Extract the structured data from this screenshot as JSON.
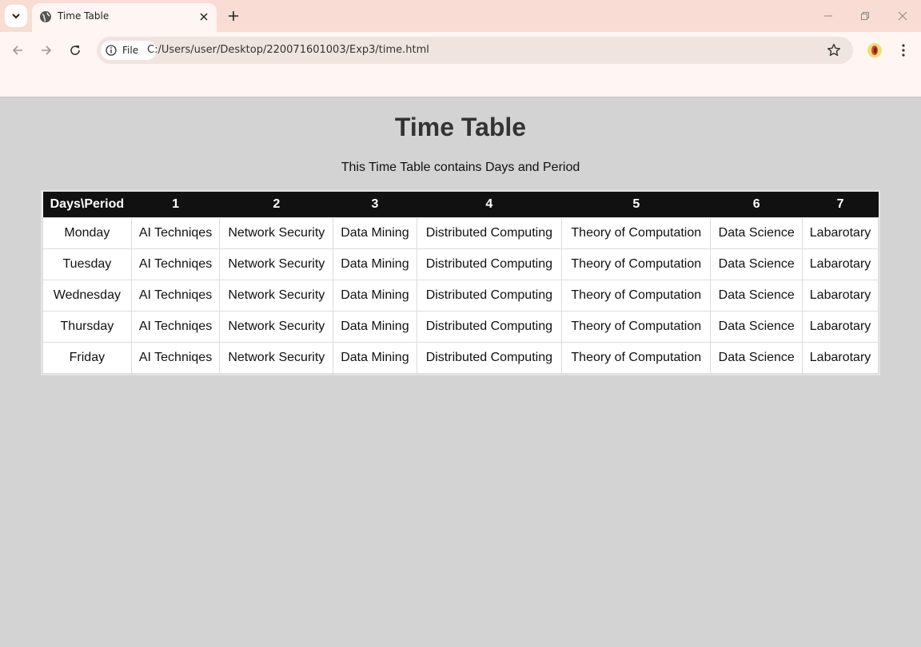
{
  "browser": {
    "tab_title": "Time Table",
    "site_chip": "File",
    "url": "C:/Users/user/Desktop/220071601003/Exp3/time.html"
  },
  "page": {
    "title": "Time Table",
    "subtitle": "This Time Table contains Days and Period"
  },
  "table": {
    "headers": [
      "Days\\Period",
      "1",
      "2",
      "3",
      "4",
      "5",
      "6",
      "7"
    ],
    "rows": [
      [
        "Monday",
        "AI Techniqes",
        "Network Security",
        "Data Mining",
        "Distributed Computing",
        "Theory of Computation",
        "Data Science",
        "Labarotary"
      ],
      [
        "Tuesday",
        "AI Techniqes",
        "Network Security",
        "Data Mining",
        "Distributed Computing",
        "Theory of Computation",
        "Data Science",
        "Labarotary"
      ],
      [
        "Wednesday",
        "AI Techniqes",
        "Network Security",
        "Data Mining",
        "Distributed Computing",
        "Theory of Computation",
        "Data Science",
        "Labarotary"
      ],
      [
        "Thursday",
        "AI Techniqes",
        "Network Security",
        "Data Mining",
        "Distributed Computing",
        "Theory of Computation",
        "Data Science",
        "Labarotary"
      ],
      [
        "Friday",
        "AI Techniqes",
        "Network Security",
        "Data Mining",
        "Distributed Computing",
        "Theory of Computation",
        "Data Science",
        "Labarotary"
      ]
    ]
  },
  "icons": [
    "tab-search-icon",
    "globe-icon",
    "close-icon",
    "plus-icon",
    "minimize-icon",
    "restore-icon",
    "window-close-icon",
    "back-arrow-icon",
    "forward-arrow-icon",
    "reload-icon",
    "info-icon",
    "star-icon",
    "extension-icon",
    "kebab-menu-icon"
  ],
  "colors": {
    "page_background": "#d3d3d3",
    "tab_strip": "#f9dcd3",
    "header_row": "#111111",
    "title_text": "#333333"
  }
}
